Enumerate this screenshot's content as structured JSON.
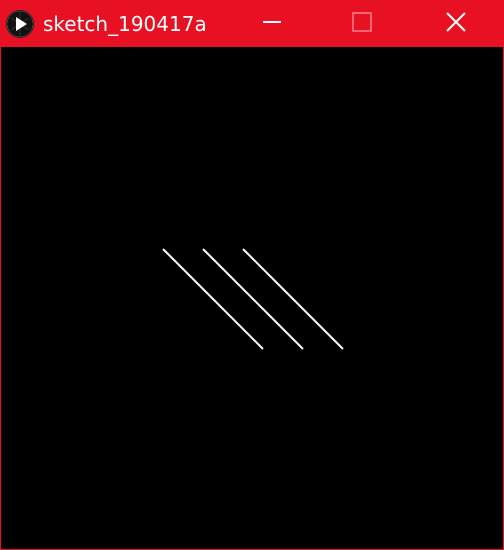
{
  "window": {
    "title": "sketch_190417a",
    "accent_color": "#e81123",
    "app_icon": "processing-play-icon",
    "controls": {
      "minimize_icon": "minimize-icon",
      "maximize_icon": "maximize-icon",
      "close_icon": "close-icon"
    }
  },
  "canvas": {
    "background": "#000000",
    "stroke_color": "#ffffff"
  }
}
